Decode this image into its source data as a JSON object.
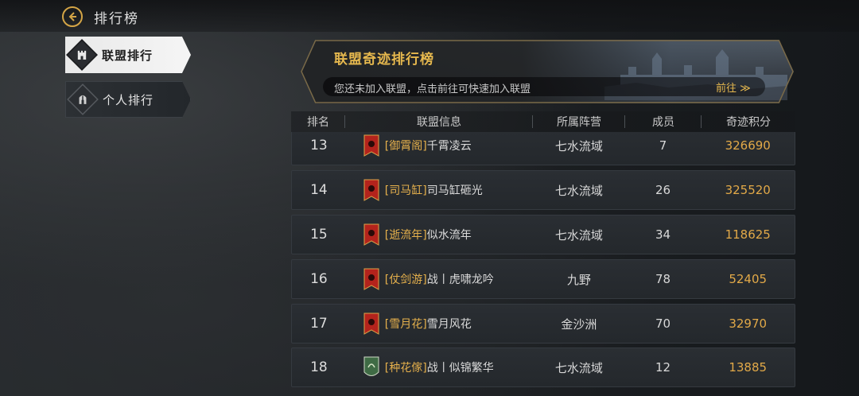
{
  "header": {
    "title": "排行榜"
  },
  "sidebar": {
    "tabs": [
      {
        "label": "联盟排行",
        "active": true
      },
      {
        "label": "个人排行",
        "active": false
      }
    ]
  },
  "banner": {
    "title": "联盟奇迹排行榜",
    "hint": "您还未加入联盟，点击前往可快速加入联盟",
    "button": "前往 ≫"
  },
  "table": {
    "columns": [
      "排名",
      "联盟信息",
      "所属阵营",
      "成员",
      "奇迹积分"
    ],
    "rows": [
      {
        "rank": "13",
        "tag": "[御霄阁]",
        "name": "千霄凌云",
        "camp": "七水流域",
        "members": "7",
        "score": "326690",
        "flag": "red"
      },
      {
        "rank": "14",
        "tag": "[司马缸]",
        "name": "司马缸砸光",
        "camp": "七水流域",
        "members": "26",
        "score": "325520",
        "flag": "red"
      },
      {
        "rank": "15",
        "tag": "[逝流年]",
        "name": "似水流年",
        "camp": "七水流域",
        "members": "34",
        "score": "118625",
        "flag": "red"
      },
      {
        "rank": "16",
        "tag": "[仗剑游]",
        "name": "战丨虎啸龙吟",
        "camp": "九野",
        "members": "78",
        "score": "52405",
        "flag": "red"
      },
      {
        "rank": "17",
        "tag": "[雪月花]",
        "name": "雪月风花",
        "camp": "金沙洲",
        "members": "70",
        "score": "32970",
        "flag": "red"
      },
      {
        "rank": "18",
        "tag": "[种花傢]",
        "name": "战丨似锦繁华",
        "camp": "七水流域",
        "members": "12",
        "score": "13885",
        "flag": "green"
      }
    ]
  },
  "colors": {
    "accent": "#e5b04c",
    "flag_red": "#b3231c",
    "flag_green": "#3f6b45"
  }
}
